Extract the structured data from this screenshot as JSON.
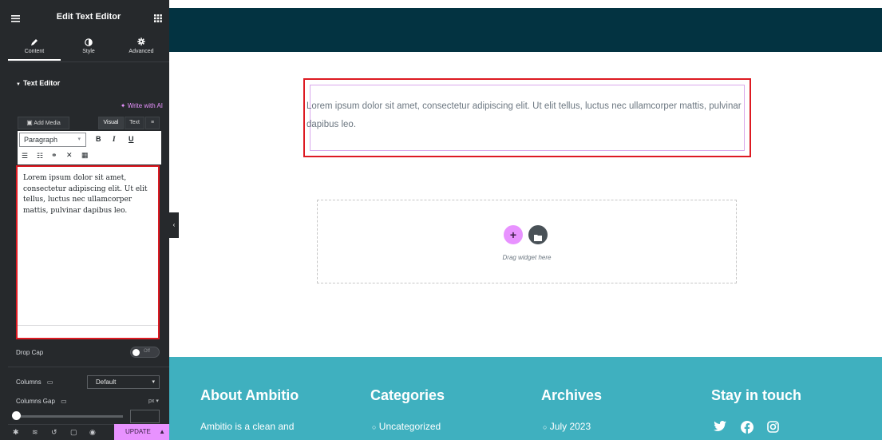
{
  "panel": {
    "title": "Edit Text Editor",
    "tabs": [
      {
        "label": "Content",
        "icon": "pencil-icon"
      },
      {
        "label": "Style",
        "icon": "contrast-icon"
      },
      {
        "label": "Advanced",
        "icon": "gear-icon"
      }
    ],
    "section_title": "Text Editor",
    "write_ai": "Write with AI",
    "add_media": "Add Media",
    "visual_tab": "Visual",
    "text_tab": "Text",
    "paragraph_select": "Paragraph",
    "editor_content": "Lorem ipsum dolor sit amet, consectetur adipiscing elit. Ut elit tellus, luctus nec ullamcorper mattis, pulvinar dapibus leo.",
    "drop_cap_label": "Drop Cap",
    "drop_cap_toggle": "Off",
    "columns_label": "Columns",
    "columns_value": "Default",
    "columns_gap_label": "Columns Gap",
    "columns_gap_unit": "px",
    "update_button": "UPDATE"
  },
  "canvas": {
    "header_color": "#033341",
    "text_widget_content": "Lorem ipsum dolor sit amet, consectetur adipiscing elit. Ut elit tellus, luctus nec ullamcorper mattis, pulvinar dapibus leo.",
    "dropzone_text": "Drag widget here"
  },
  "footer": {
    "columns": [
      {
        "title": "About Ambitio",
        "item": "Ambitio is a clean and"
      },
      {
        "title": "Categories",
        "item": "Uncategorized"
      },
      {
        "title": "Archives",
        "item": "July 2023"
      },
      {
        "title": "Stay in touch",
        "social": [
          "twitter-icon",
          "facebook-icon",
          "instagram-icon"
        ]
      }
    ],
    "bg_color": "#3fb0bf"
  },
  "colors": {
    "accent": "#e892ff",
    "highlight": "#dd1a22",
    "panel_bg": "#26292c"
  }
}
